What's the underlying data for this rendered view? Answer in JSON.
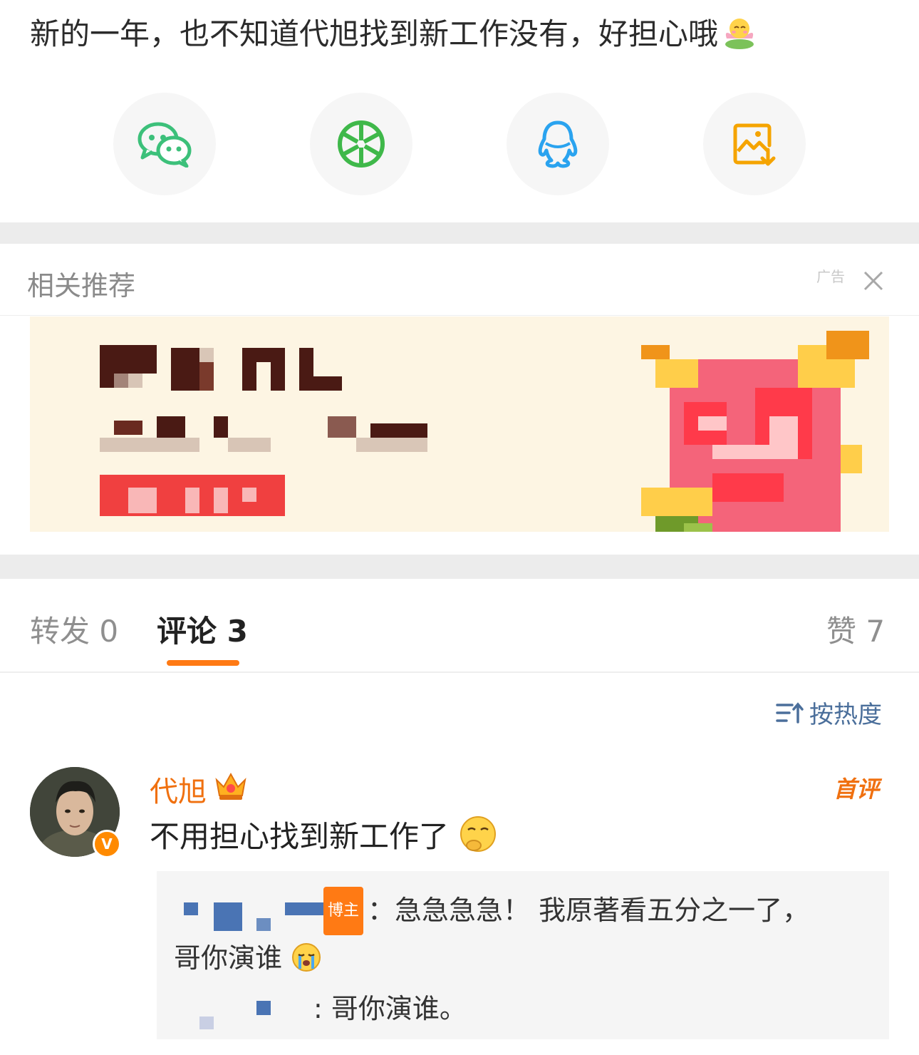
{
  "post": {
    "text": "新的一年，也不知道代旭找到新工作没有，好担心哦",
    "emoji": "lotus-blush-emoji"
  },
  "share": [
    {
      "name": "wechat-icon",
      "color": "#3cc07a"
    },
    {
      "name": "moments-icon",
      "color": "#3fb84a"
    },
    {
      "name": "qq-icon",
      "color": "#2aa3ef"
    },
    {
      "name": "save-image-icon",
      "color": "#f5a400"
    }
  ],
  "recommend": {
    "title": "相关推荐",
    "ad_label": "广告"
  },
  "tabs": {
    "repost": "转发 0",
    "comments": "评论 3",
    "likes": "赞 7"
  },
  "sort": {
    "label": "按热度"
  },
  "comment": {
    "user": "代旭",
    "first_badge": "首评",
    "text": "不用担心找到新工作了",
    "reply_host_badge": "博主",
    "reply1_text": "：急急急急！ 我原著看五分之一了，",
    "reply1_line2": "哥你演谁",
    "reply2_text": ": 哥你演谁。"
  }
}
